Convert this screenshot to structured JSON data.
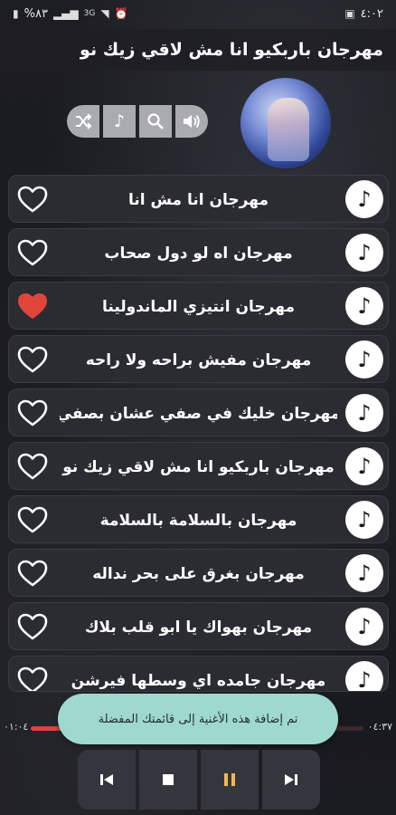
{
  "status_bar": {
    "time": "٤:٠٢",
    "battery": "%٨٣",
    "network": "3G"
  },
  "header": {
    "title": "مهرجان باربكيو انا مش لاقي زيك نو"
  },
  "controls": {
    "icons": [
      "shuffle-icon",
      "music-note-icon",
      "search-icon",
      "volume-icon"
    ]
  },
  "songs": [
    {
      "title": "مهرجان انا مش انا",
      "favorite": false
    },
    {
      "title": "مهرجان اه لو دول صحاب",
      "favorite": false
    },
    {
      "title": "مهرجان انتيزي الماندولينا",
      "favorite": true
    },
    {
      "title": "مهرجان مفيش براحه ولا راحه",
      "favorite": false
    },
    {
      "title": "مهرجان خليك في صفي عشان بصفي",
      "favorite": false
    },
    {
      "title": "مهرجان باربكيو انا مش لاقي زيك نو",
      "favorite": false
    },
    {
      "title": "مهرجان بالسلامة بالسلامة",
      "favorite": false
    },
    {
      "title": "مهرجان بغرق على بحر نداله",
      "favorite": false
    },
    {
      "title": "مهرجان بهواك يا ابو قلب بلاك",
      "favorite": false
    },
    {
      "title": "مهرجان جامده اي وسطها فيرشن",
      "favorite": false
    }
  ],
  "player": {
    "elapsed": "٠١:٠٤",
    "duration": "٠٤:٣٧",
    "progress_fraction": 0.24
  },
  "toast": {
    "message": "تم إضافة هذه الأغنية إلى قائمتك المفضلة"
  },
  "colors": {
    "heart_active": "#e0453a",
    "progress": "#e04040",
    "toast_bg": "#9fd8cf",
    "pause_accent": "#f3b84a"
  }
}
